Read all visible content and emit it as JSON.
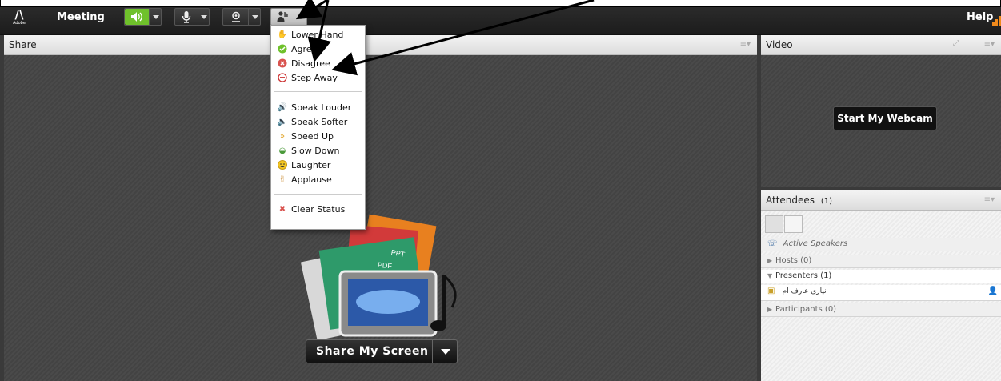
{
  "topbar": {
    "logo_text": "Adobe",
    "meeting_menu": "Meeting",
    "help_menu": "Help",
    "accent_speaker": "#6fc12b",
    "signal_color": "#f08a1c"
  },
  "share_pod": {
    "title": "Share",
    "share_button_label": "Share My Screen",
    "thumb_ppt": "PPT",
    "thumb_pdf": "PDF"
  },
  "video_pod": {
    "title": "Video",
    "start_webcam_label": "Start My Webcam"
  },
  "attendees_pod": {
    "title": "Attendees",
    "count": "(1)",
    "active_speakers": "Active Speakers",
    "hosts": "Hosts (0)",
    "presenters": "Presenters (1)",
    "presenter_name": "نیاری عارف ام",
    "participants": "Participants (0)"
  },
  "status_menu": {
    "items": [
      {
        "label": "Lower Hand",
        "icon": "hand-icon"
      },
      {
        "label": "Agree",
        "icon": "check-circle-icon"
      },
      {
        "label": "Disagree",
        "icon": "x-circle-icon"
      },
      {
        "label": "Step Away",
        "icon": "minus-circle-icon"
      },
      {
        "label": "Speak Louder",
        "icon": "speaker-loud-icon"
      },
      {
        "label": "Speak Softer",
        "icon": "speaker-soft-icon"
      },
      {
        "label": "Speed Up",
        "icon": "rabbit-icon"
      },
      {
        "label": "Slow Down",
        "icon": "turtle-icon"
      },
      {
        "label": "Laughter",
        "icon": "smiley-icon"
      },
      {
        "label": "Applause",
        "icon": "clap-icon"
      },
      {
        "label": "Clear Status",
        "icon": "clear-x-icon"
      }
    ]
  }
}
